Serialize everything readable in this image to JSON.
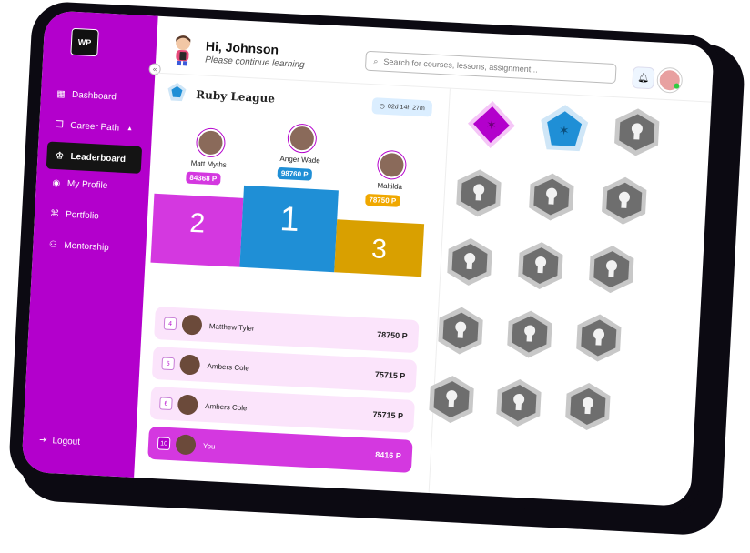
{
  "sidebar": {
    "logo_text": "WP",
    "items": [
      {
        "label": "Dashboard",
        "icon": "grid-icon"
      },
      {
        "label": "Career Path",
        "icon": "book-icon"
      },
      {
        "label": "Leaderboard",
        "icon": "trophy-icon"
      },
      {
        "label": "My Profile",
        "icon": "user-circle-icon"
      },
      {
        "label": "Portfolio",
        "icon": "portfolio-icon"
      },
      {
        "label": "Mentorship",
        "icon": "group-icon"
      }
    ],
    "logout": "Logout"
  },
  "header": {
    "greeting": "Hi, Johnson",
    "subtitle": "Please continue learning",
    "search_placeholder": "Search for courses, lessons, assignment..."
  },
  "league": {
    "title": "Ruby League",
    "timer": "02d 14h 27m",
    "podium": [
      {
        "place": "2",
        "name": "Matt Myths",
        "points": "84368 P"
      },
      {
        "place": "1",
        "name": "Anger Wade",
        "points": "98760 P"
      },
      {
        "place": "3",
        "name": "Maltilda",
        "points": "78750 P"
      }
    ],
    "rows": [
      {
        "rank": "4",
        "name": "Matthew Tyler",
        "points": "78750 P"
      },
      {
        "rank": "5",
        "name": "Ambers Cole",
        "points": "75715 P"
      },
      {
        "rank": "6",
        "name": "Ambers Cole",
        "points": "75715 P"
      },
      {
        "rank": "10",
        "name": "You",
        "points": "8416 P"
      }
    ]
  },
  "colors": {
    "brand": "#b300cc",
    "first": "#1f8fd6",
    "second": "#d438e0",
    "third": "#f0a800",
    "locked": "#6e6e6e"
  },
  "badges": [
    {
      "name": "amethyst-badge",
      "state": "unlocked"
    },
    {
      "name": "sapphire-badge",
      "state": "unlocked"
    },
    {
      "name": "locked-badge",
      "state": "locked"
    }
  ]
}
